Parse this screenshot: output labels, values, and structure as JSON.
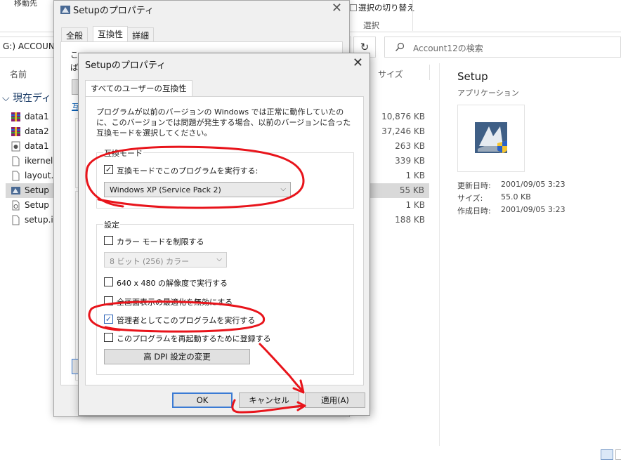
{
  "explorer": {
    "ribbon": {
      "move_label": "移動先",
      "select_toggle_label": "選択の切り替え",
      "select_group_label": "選択"
    },
    "address_text": "G:) ACCOUNT",
    "refresh_glyph": "↻",
    "search_placeholder": "Account12の検索",
    "column_name": "名前",
    "column_size": "サイズ",
    "nav_current": "現在ディ",
    "files": [
      {
        "name": "data1",
        "size": "10,876 KB",
        "icon": "rar-archive-icon"
      },
      {
        "name": "data2",
        "size": "37,246 KB",
        "icon": "rar-archive-icon"
      },
      {
        "name": "data1",
        "size": "263 KB",
        "icon": "setup-data-icon"
      },
      {
        "name": "ikernel.",
        "size": "339 KB",
        "icon": "file-icon"
      },
      {
        "name": "layout.b",
        "size": "1 KB",
        "icon": "file-icon"
      },
      {
        "name": "Setup",
        "size": "55 KB",
        "icon": "setup-app-icon"
      },
      {
        "name": "Setup",
        "size": "1 KB",
        "icon": "settings-file-icon"
      },
      {
        "name": "setup.in",
        "size": "188 KB",
        "icon": "file-icon"
      }
    ],
    "details": {
      "title": "Setup",
      "type": "アプリケーション",
      "modified_label": "更新日時:",
      "modified_value": "2001/09/05 3:23",
      "size_label": "サイズ:",
      "size_value": "55.0 KB",
      "created_label": "作成日時:",
      "created_value": "2001/09/05 3:23"
    }
  },
  "back_window": {
    "title": "Setupのプロパティ",
    "close_glyph": "✕",
    "tabs": [
      "全般",
      "互換性",
      "詳細"
    ],
    "fragment_c": "こ",
    "fragment_ha": "ば",
    "fragment_link": "互"
  },
  "dialog": {
    "title": "Setupのプロパティ",
    "close_glyph": "✕",
    "tab": "すべてのユーザーの互換性",
    "description": "プログラムが以前のバージョンの Windows では正常に動作していたのに、このバージョンでは問題が発生する場合、以前のバージョンに合った互換モードを選択してください。",
    "compat_group_label": "互換モード",
    "compat_checkbox_label": "互換モードでこのプログラムを実行する:",
    "compat_checked_glyph": "☑",
    "compat_select_value": "Windows XP (Service Pack 2)",
    "caret_glyph": "⌵",
    "settings_group_label": "設定",
    "color_mode_label": "カラー モードを制限する",
    "color_select_value": "8 ビット (256) カラー",
    "res_label": "640 x 480 の解像度で実行する",
    "fullscreen_label": "全画面表示の最適化を無効にする",
    "admin_label": "管理者としてこのプログラムを実行する",
    "admin_checked_glyph": "✓",
    "restart_label": "このプログラムを再起動するために登録する",
    "dpi_button": "高 DPI 設定の変更",
    "ok_button": "OK",
    "cancel_button": "キャンセル",
    "apply_button": "適用(A)"
  },
  "colors": {
    "annotation_red": "#e8141b",
    "accent_blue": "#3b7bd4"
  }
}
